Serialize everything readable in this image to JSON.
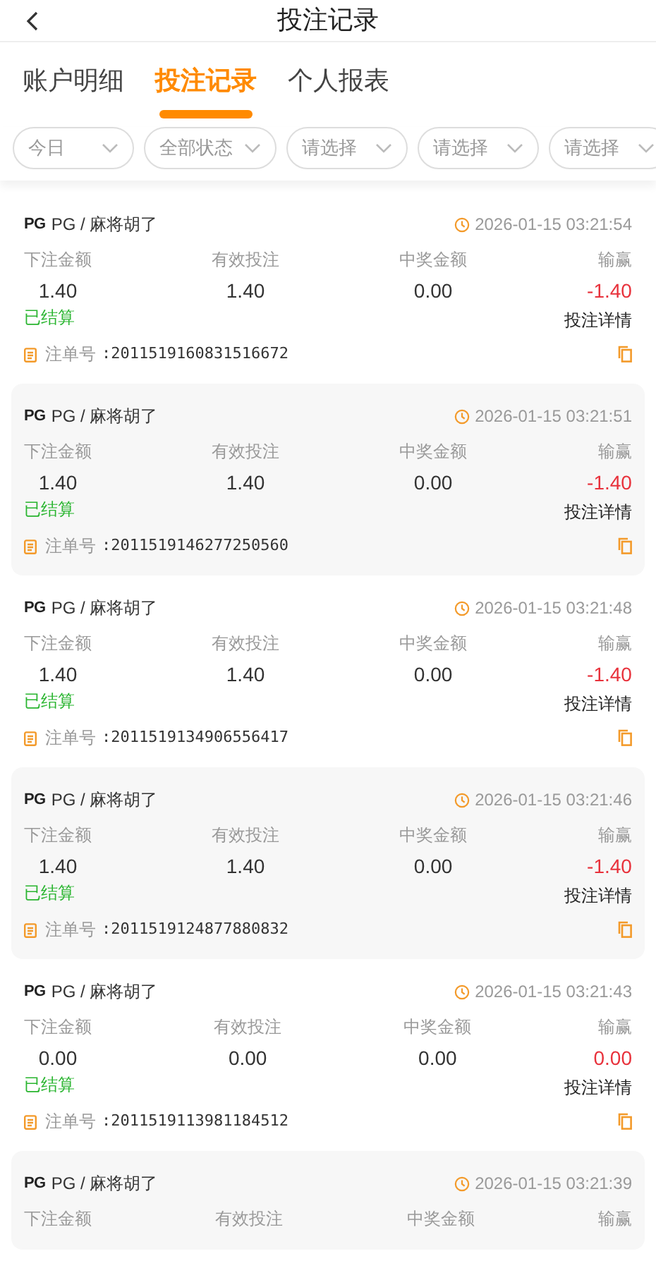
{
  "header": {
    "title": "投注记录"
  },
  "tabs": [
    {
      "label": "账户明细",
      "selected": false
    },
    {
      "label": "投注记录",
      "selected": true
    },
    {
      "label": "个人报表",
      "selected": false
    }
  ],
  "filters": [
    "今日",
    "全部状态",
    "请选择",
    "请选择",
    "请选择"
  ],
  "records": [
    {
      "logo": "PG",
      "game": "PG / 麻将胡了",
      "time": "2026-01-15 03:21:54",
      "labels": [
        "下注金额",
        "有效投注",
        "中奖金额",
        "输赢"
      ],
      "bet": "1.40",
      "valid": "1.40",
      "win": "0.00",
      "result": "-1.40",
      "status": "已结算",
      "detail": "投注详情",
      "order_label": "注单号",
      "order_no": ":2011519160831516672"
    },
    {
      "logo": "PG",
      "game": "PG / 麻将胡了",
      "time": "2026-01-15 03:21:51",
      "labels": [
        "下注金额",
        "有效投注",
        "中奖金额",
        "输赢"
      ],
      "bet": "1.40",
      "valid": "1.40",
      "win": "0.00",
      "result": "-1.40",
      "status": "已结算",
      "detail": "投注详情",
      "order_label": "注单号",
      "order_no": ":2011519146277250560"
    },
    {
      "logo": "PG",
      "game": "PG / 麻将胡了",
      "time": "2026-01-15 03:21:48",
      "labels": [
        "下注金额",
        "有效投注",
        "中奖金额",
        "输赢"
      ],
      "bet": "1.40",
      "valid": "1.40",
      "win": "0.00",
      "result": "-1.40",
      "status": "已结算",
      "detail": "投注详情",
      "order_label": "注单号",
      "order_no": ":2011519134906556417"
    },
    {
      "logo": "PG",
      "game": "PG / 麻将胡了",
      "time": "2026-01-15 03:21:46",
      "labels": [
        "下注金额",
        "有效投注",
        "中奖金额",
        "输赢"
      ],
      "bet": "1.40",
      "valid": "1.40",
      "win": "0.00",
      "result": "-1.40",
      "status": "已结算",
      "detail": "投注详情",
      "order_label": "注单号",
      "order_no": ":2011519124877880832"
    },
    {
      "logo": "PG",
      "game": "PG / 麻将胡了",
      "time": "2026-01-15 03:21:43",
      "labels": [
        "下注金额",
        "有效投注",
        "中奖金额",
        "输赢"
      ],
      "bet": "0.00",
      "valid": "0.00",
      "win": "0.00",
      "result": "0.00",
      "status": "已结算",
      "detail": "投注详情",
      "order_label": "注单号",
      "order_no": ":2011519113981184512"
    },
    {
      "logo": "PG",
      "game": "PG / 麻将胡了",
      "time": "2026-01-15 03:21:39",
      "labels": [
        "下注金额",
        "有效投注",
        "中奖金额",
        "输赢"
      ]
    }
  ]
}
